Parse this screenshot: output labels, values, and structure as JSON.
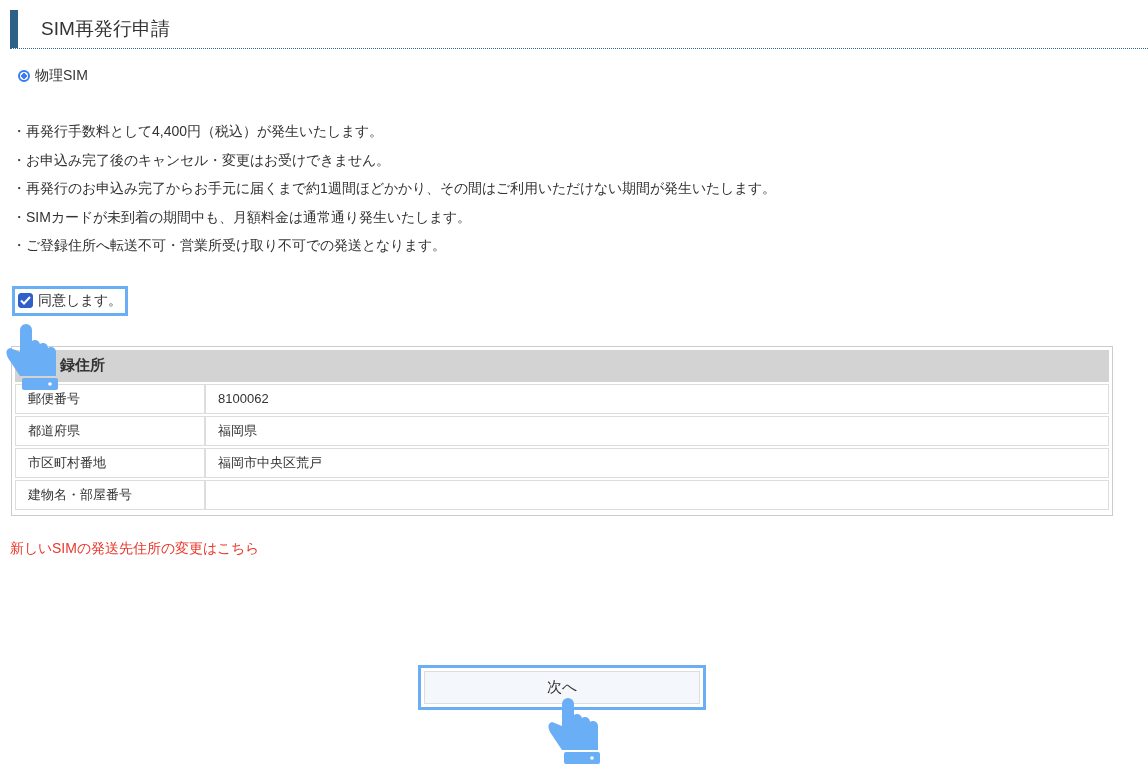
{
  "heading": "SIM再発行申請",
  "sim_options": [
    {
      "label": "物理SIM",
      "selected": true
    }
  ],
  "notices": [
    "・再発行手数料として4,400円（税込）が発生いたします。",
    "・お申込み完了後のキャンセル・変更はお受けできません。",
    "・再発行のお申込み完了からお手元に届くまで約1週間ほどかかり、その間はご利用いただけない期間が発生いたします。",
    "・SIMカードが未到着の期間中も、月額料金は通常通り発生いたします。",
    "・ご登録住所へ転送不可・営業所受け取り不可での発送となります。"
  ],
  "agree": {
    "label": "同意します。",
    "checked": true
  },
  "address": {
    "title": "録住所",
    "rows": [
      {
        "label": "郵便番号",
        "value": "8100062"
      },
      {
        "label": "都道府県",
        "value": "福岡県"
      },
      {
        "label": "市区町村番地",
        "value": "福岡市中央区荒戸"
      },
      {
        "label": "建物名・部屋番号"
      }
    ]
  },
  "change_link": "新しいSIMの発送先住所の変更はこちら",
  "next_button": "次へ"
}
